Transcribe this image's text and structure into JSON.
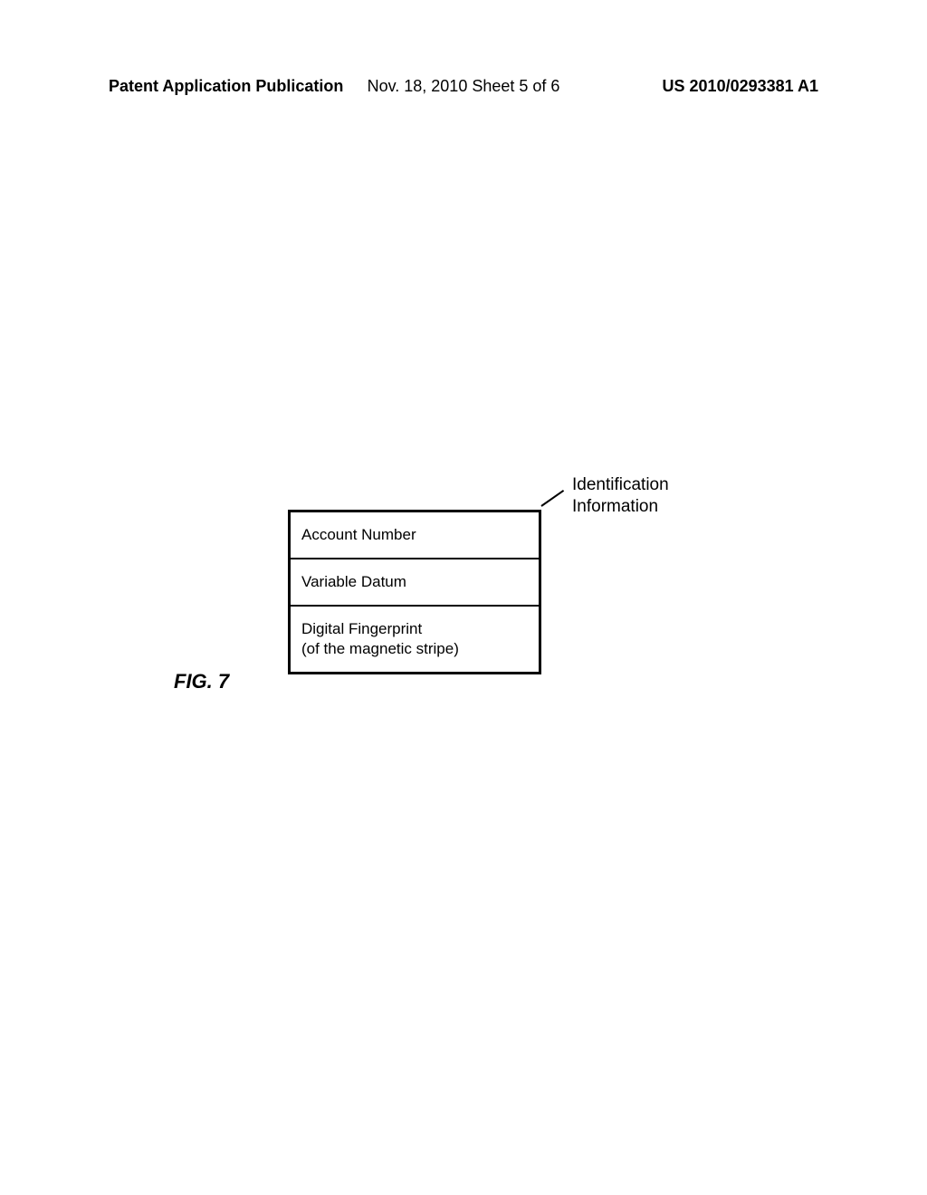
{
  "header": {
    "left": "Patent Application Publication",
    "center": "Nov. 18, 2010  Sheet 5 of 6",
    "right": "US 2010/0293381 A1"
  },
  "figure": {
    "label": "FIG. 7",
    "callout": "Identification\nInformation",
    "rows": [
      "Account Number",
      "Variable Datum",
      "Digital Fingerprint\n(of the magnetic stripe)"
    ]
  }
}
